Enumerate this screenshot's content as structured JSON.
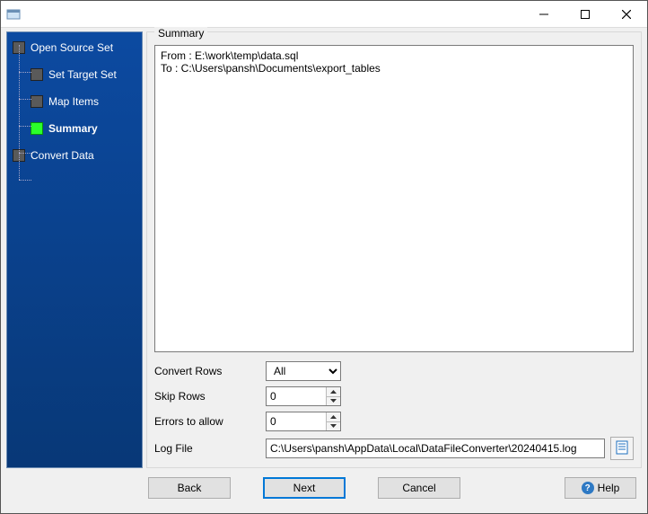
{
  "window": {
    "title": ""
  },
  "sidebar": {
    "items": [
      {
        "label": "Open Source Set"
      },
      {
        "label": "Set Target Set"
      },
      {
        "label": "Map Items"
      },
      {
        "label": "Summary",
        "active": true
      },
      {
        "label": "Convert Data"
      }
    ]
  },
  "summary": {
    "title": "Summary",
    "lines": "From : E:\\work\\temp\\data.sql\nTo : C:\\Users\\pansh\\Documents\\export_tables"
  },
  "form": {
    "convert_rows": {
      "label": "Convert Rows",
      "value": "All",
      "options": [
        "All"
      ]
    },
    "skip_rows": {
      "label": "Skip Rows",
      "value": "0"
    },
    "errors": {
      "label": "Errors to allow",
      "value": "0"
    },
    "log_file": {
      "label": "Log File",
      "value": "C:\\Users\\pansh\\AppData\\Local\\DataFileConverter\\20240415.log"
    }
  },
  "buttons": {
    "back": "Back",
    "next": "Next",
    "cancel": "Cancel",
    "help": "Help"
  }
}
